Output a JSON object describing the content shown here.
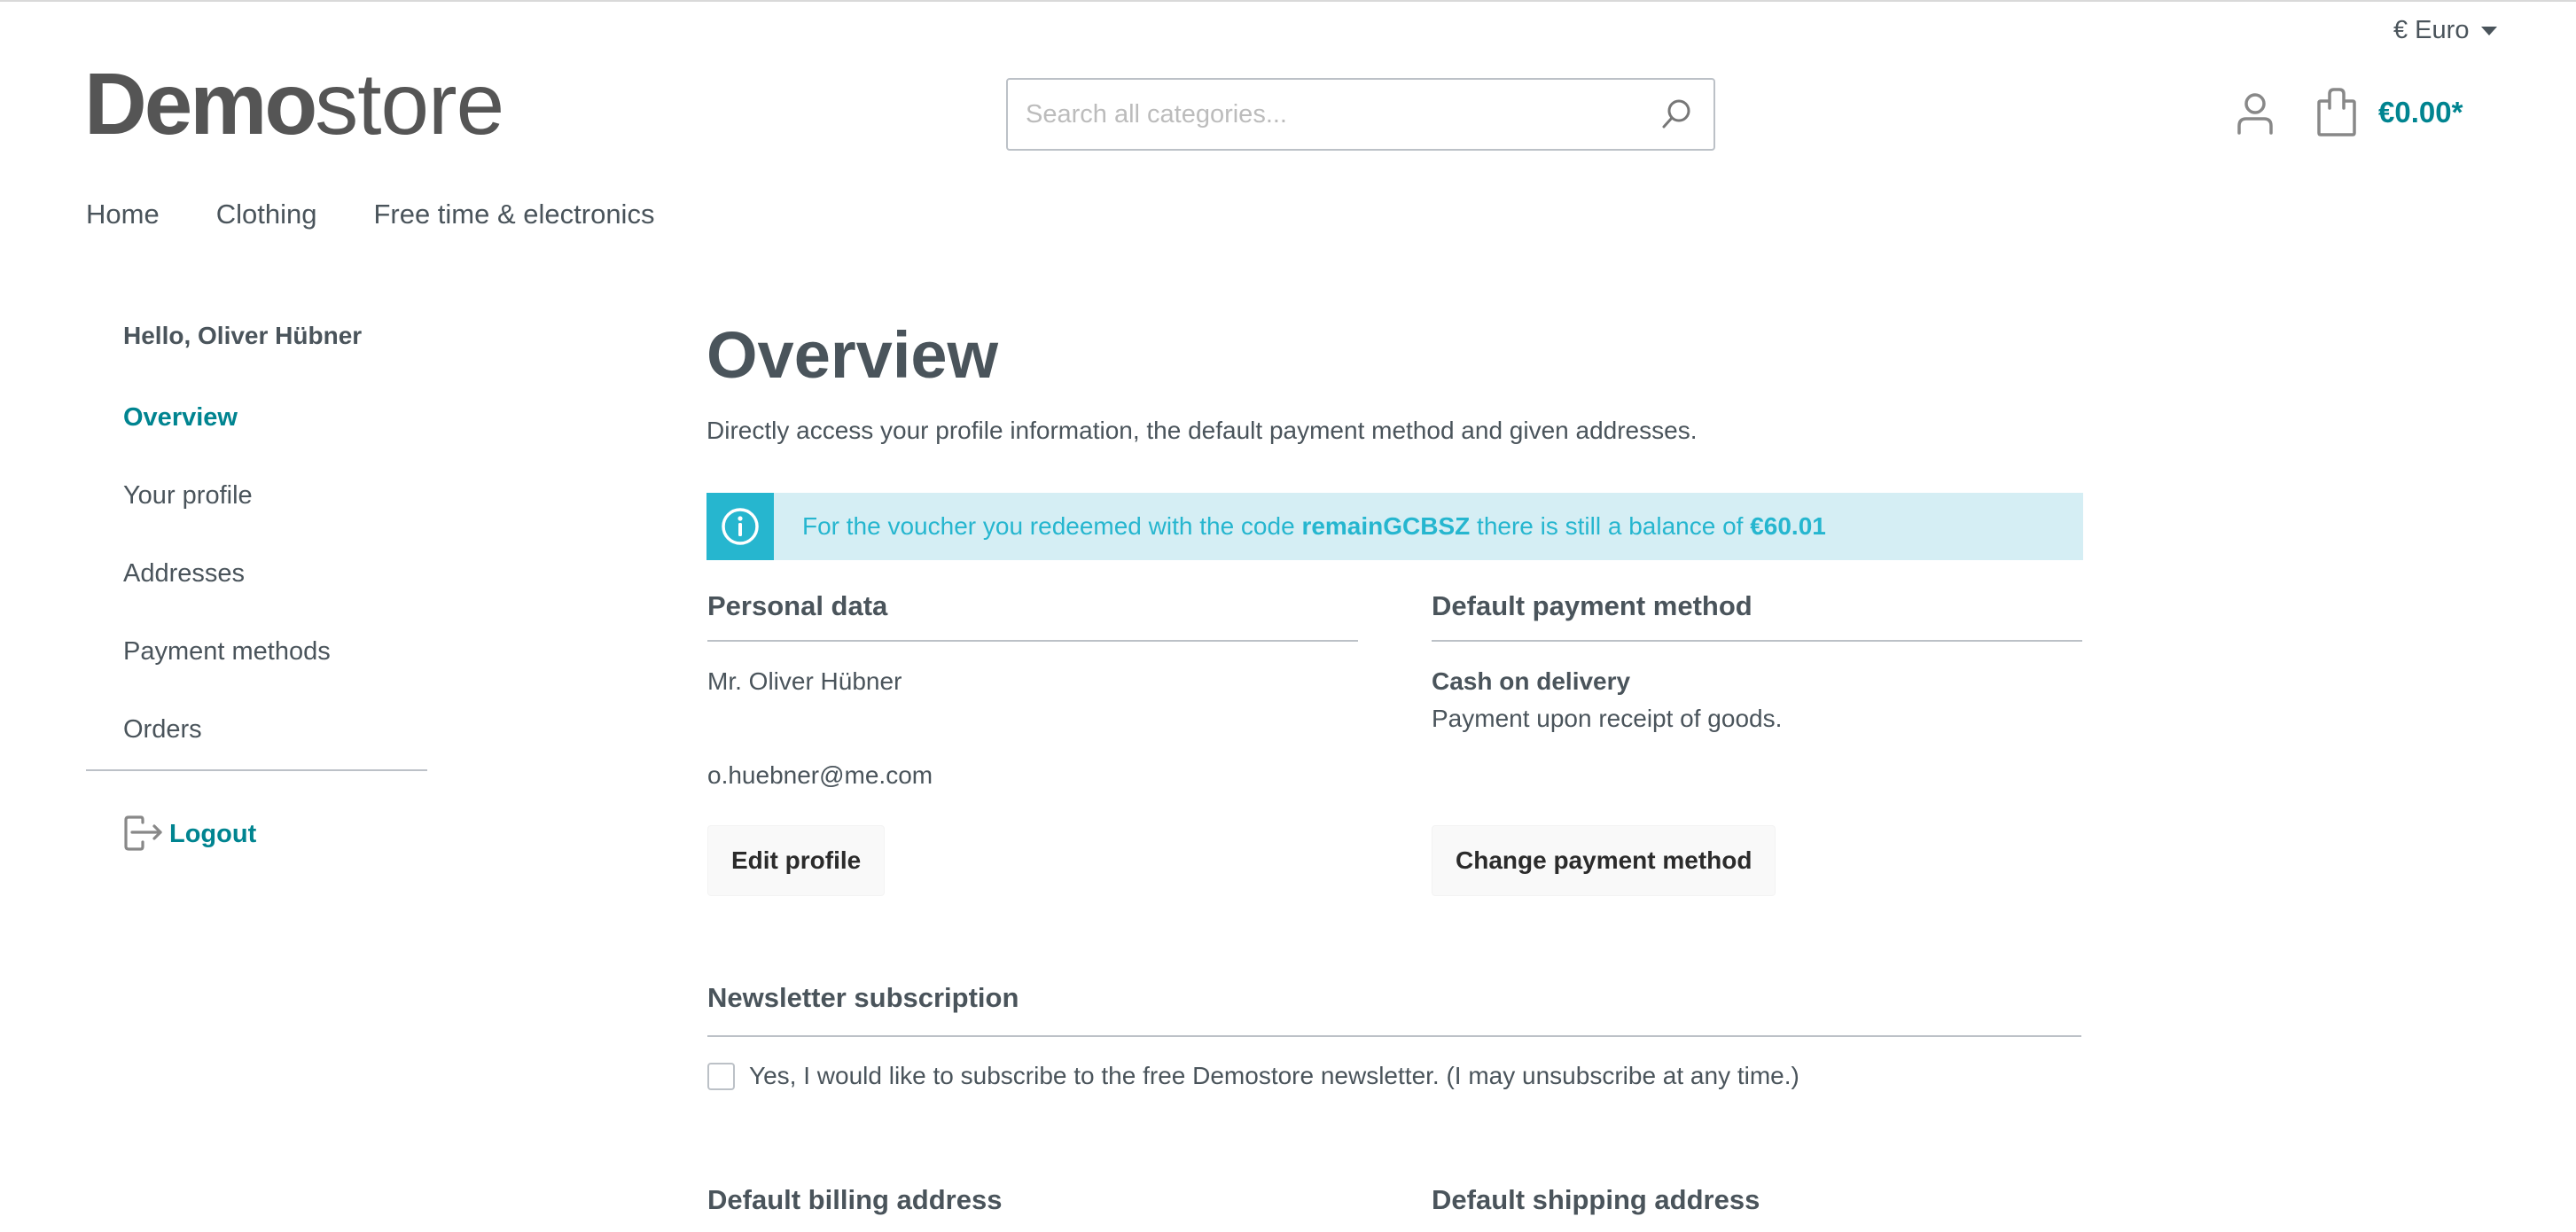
{
  "header": {
    "currency": {
      "label": "€ Euro"
    },
    "logo": {
      "bold": "Demo",
      "light": "store"
    },
    "search": {
      "placeholder": "Search all categories...",
      "value": ""
    },
    "cart": {
      "total": "€0.00*"
    }
  },
  "nav": {
    "items": [
      {
        "label": "Home"
      },
      {
        "label": "Clothing"
      },
      {
        "label": "Free time & electronics"
      }
    ]
  },
  "sidebar": {
    "greeting": "Hello, Oliver Hübner",
    "items": [
      {
        "label": "Overview",
        "active": true
      },
      {
        "label": "Your profile"
      },
      {
        "label": "Addresses"
      },
      {
        "label": "Payment methods"
      },
      {
        "label": "Orders"
      }
    ],
    "logout": "Logout"
  },
  "main": {
    "title": "Overview",
    "description": "Directly access your profile information, the default payment method and given addresses.",
    "alert": {
      "prefix": "For the voucher you redeemed with the code ",
      "code": "remainGCBSZ",
      "middle": " there is still a balance of ",
      "balance": "€60.01"
    },
    "personal": {
      "title": "Personal data",
      "name": "Mr. Oliver Hübner",
      "email": "o.huebner@me.com",
      "button": "Edit profile"
    },
    "payment": {
      "title": "Default payment method",
      "method": "Cash on delivery",
      "description": "Payment upon receipt of goods.",
      "button": "Change payment method"
    },
    "newsletter": {
      "title": "Newsletter subscription",
      "checkbox_label": "Yes, I would like to subscribe to the free Demostore newsletter. (I may unsubscribe at any time.)",
      "checked": false
    },
    "billing": {
      "title": "Default billing address"
    },
    "shipping": {
      "title": "Default shipping address"
    }
  },
  "colors": {
    "accent": "#008490",
    "info": "#26b6cf",
    "info_bg": "#d5eef4",
    "text": "#4a545b",
    "border": "#bcc1c7"
  }
}
